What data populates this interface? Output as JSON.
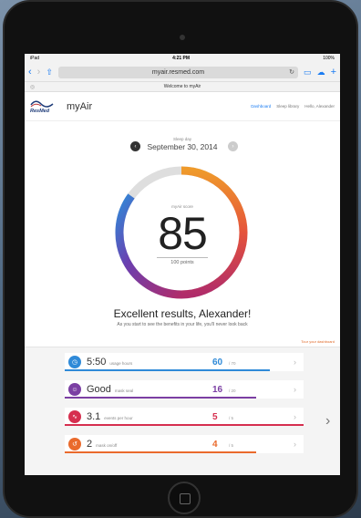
{
  "status": {
    "device": "iPad",
    "time": "4:21 PM",
    "battery": "100%"
  },
  "browser": {
    "url": "myair.resmed.com",
    "tab_title": "Welcome to myAir"
  },
  "brand": {
    "company": "ResMed",
    "app_name": "myAir"
  },
  "nav": {
    "dashboard": "Dashboard",
    "sleep_library": "Sleep library",
    "user": "Hello, Alexander"
  },
  "date": {
    "label": "Sleep day",
    "value": "September 30, 2014"
  },
  "score": {
    "label": "myAir score",
    "value": "85",
    "points": "100 points",
    "fraction": 0.85
  },
  "message": {
    "headline": "Excellent results, Alexander!",
    "sub": "As you start to see the benefits in your life, you'll never look back",
    "tour": "Tour your dashboard"
  },
  "metrics": [
    {
      "icon": "clock-icon",
      "value": "5:50",
      "label": "usage hours",
      "points": "60",
      "max": "/ 70",
      "color": "#2f8ad8",
      "fraction": 0.86
    },
    {
      "icon": "mask-seal-icon",
      "value": "Good",
      "label": "mask seal",
      "points": "16",
      "max": "/ 20",
      "color": "#7b3fa3",
      "fraction": 0.8
    },
    {
      "icon": "events-icon",
      "value": "3.1",
      "label": "events per hour",
      "points": "5",
      "max": "/ 5",
      "color": "#d62f4f",
      "fraction": 1.0
    },
    {
      "icon": "mask-on-off-icon",
      "value": "2",
      "label": "mask on/off",
      "points": "4",
      "max": "/ 5",
      "color": "#ea6a2c",
      "fraction": 0.8
    }
  ],
  "colors": {
    "accent": "#1a7cf2",
    "gauge_start": "#ef9a2b",
    "gauge_mid": "#d62f4f",
    "gauge_end": "#2f8ad8"
  }
}
